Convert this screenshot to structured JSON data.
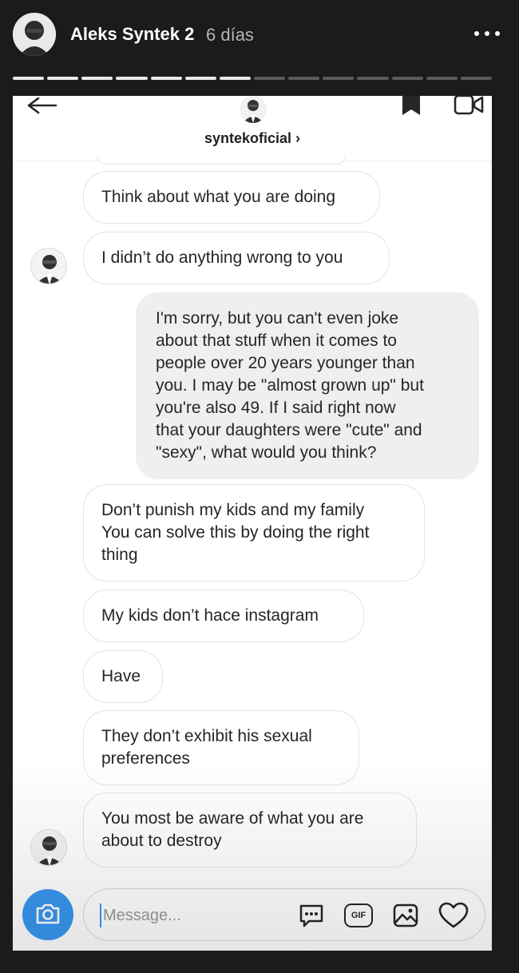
{
  "story": {
    "username": "Aleks Syntek 2",
    "time": "6 días",
    "progress": {
      "segments": 14,
      "completed": 7
    }
  },
  "dm": {
    "username": "syntekoficial",
    "chevron": "›",
    "icons": {
      "back": "back-arrow-icon",
      "flag": "flag-icon",
      "video": "video-camera-icon"
    }
  },
  "messages": [
    {
      "sender": "them",
      "text": "Think about what you are doing"
    },
    {
      "sender": "them",
      "text": "I didn’t do anything wrong to you"
    },
    {
      "sender": "me",
      "text": "I'm sorry, but you can't even joke\nabout that stuff when it comes to\npeople over 20 years younger than\nyou.  I may be \"almost grown up\" but\nyou're also 49.  If I said right now\nthat your daughters were \"cute\" and\n\"sexy\", what would you think?"
    },
    {
      "sender": "them",
      "text": "Don’t punish my kids and my family\nYou can solve this by doing the right\nthing"
    },
    {
      "sender": "them",
      "text": "My kids don’t hace instagram"
    },
    {
      "sender": "them",
      "text": "Have"
    },
    {
      "sender": "them",
      "text": "They don’t exhibit his sexual\npreferences"
    },
    {
      "sender": "them",
      "text": "You most be aware of what you are\nabout to destroy"
    }
  ],
  "composer": {
    "placeholder": "Message...",
    "value": "",
    "gif_label": "GIF",
    "icons": [
      "camera-icon",
      "chat-sticker-icon",
      "gif-icon",
      "gallery-icon",
      "heart-icon"
    ]
  },
  "colors": {
    "accent": "#3897f0",
    "story_bg": "#1b1b1b",
    "my_bubble": "#efefef"
  }
}
